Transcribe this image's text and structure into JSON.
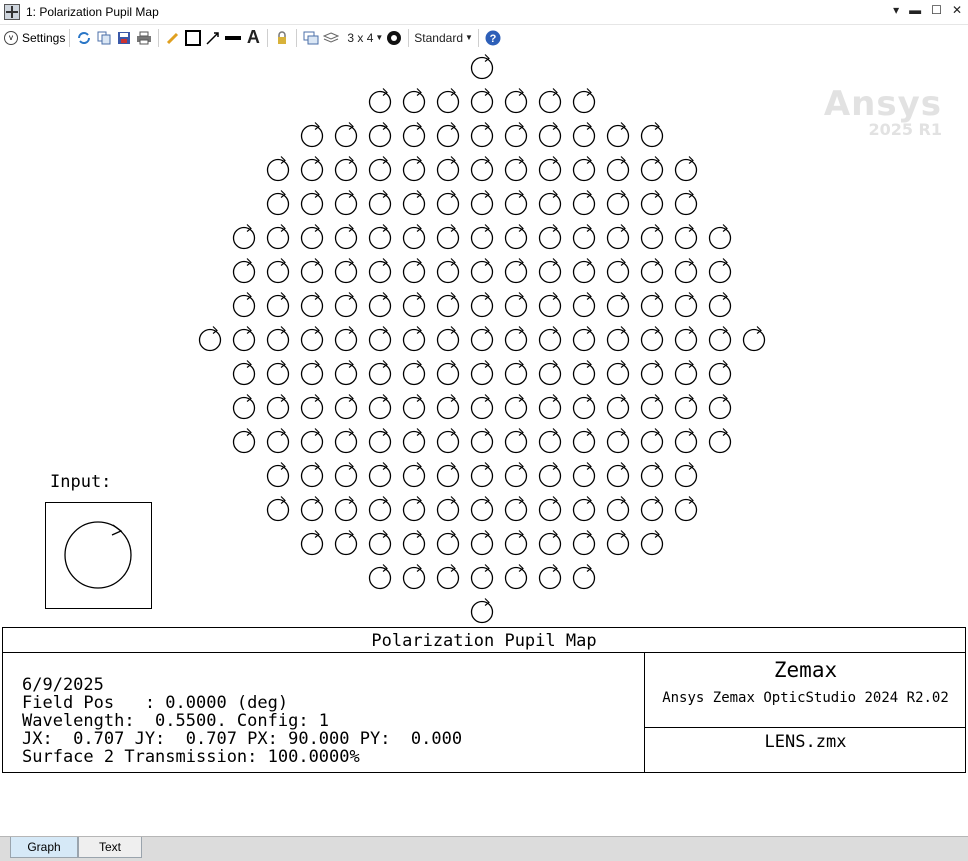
{
  "window": {
    "title": "1: Polarization Pupil Map"
  },
  "toolbar": {
    "settings_label": "Settings",
    "layout_label": "3 x 4",
    "mode_label": "Standard",
    "icons": [
      "refresh-icon",
      "copy-icon",
      "save-icon",
      "print-icon",
      "pencil-icon",
      "rectangle-icon",
      "arrow-icon",
      "line-icon",
      "text-icon",
      "lock-icon",
      "windows-icon",
      "layers-icon",
      "dropdown-icon",
      "compass-icon",
      "dropdown-icon",
      "help-icon"
    ]
  },
  "watermark": {
    "brand": "Ansys",
    "version": "2025 R1"
  },
  "plot": {
    "row_counts": [
      1,
      7,
      11,
      13,
      13,
      15,
      15,
      15,
      17,
      15,
      15,
      15,
      13,
      13,
      11,
      7,
      1
    ],
    "ellipse_type": "circular"
  },
  "input": {
    "label": "Input:"
  },
  "info": {
    "title": "Polarization Pupil Map",
    "date": "6/9/2025",
    "field_pos": "Field Pos   : 0.0000 (deg)",
    "wavelength": "Wavelength:  0.5500. Config: 1",
    "jones": "JX:  0.707 JY:  0.707 PX: 90.000 PY:  0.000",
    "transmission": "Surface 2 Transmission: 100.0000%",
    "brand": "Zemax",
    "product": "Ansys Zemax OpticStudio 2024 R2.02",
    "filename": "LENS.zmx"
  },
  "tabs": [
    "Graph",
    "Text"
  ]
}
